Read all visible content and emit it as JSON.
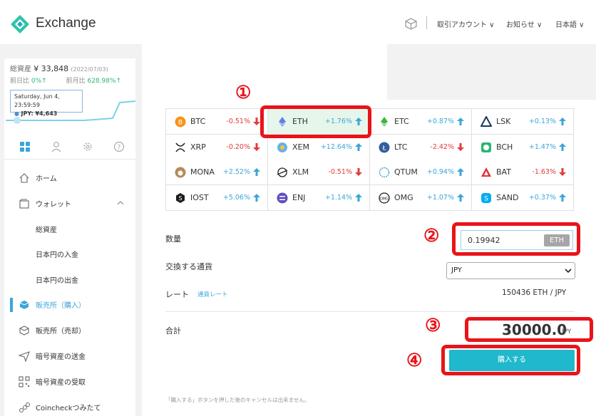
{
  "header": {
    "app_name": "Exchange",
    "links": [
      "取引アカウント ∨",
      "お知らせ ∨",
      "日本語 ∨"
    ]
  },
  "sidebar": {
    "total_label": "総資産",
    "total_value": "¥ 33,848",
    "total_date": "(2022/07/03)",
    "prev_day_label": "前日比",
    "prev_day_value": "0%↑",
    "prev_month_label": "前月比",
    "prev_month_value": "628.98%↑",
    "tooltip_date": "Saturday, Jun 4, 23:59:59",
    "tooltip_value": "JPY: ¥4,643",
    "nav": [
      {
        "label": "ホーム"
      },
      {
        "label": "ウォレット"
      },
      {
        "label": "総資産"
      },
      {
        "label": "日本円の入金"
      },
      {
        "label": "日本円の出金"
      },
      {
        "label": "販売所（購入）"
      },
      {
        "label": "販売所（売却）"
      },
      {
        "label": "暗号資産の送金"
      },
      {
        "label": "暗号資産の受取"
      },
      {
        "label": "Coincheckつみたて"
      }
    ]
  },
  "coins": [
    {
      "symbol": "BTC",
      "change": "-0.51%",
      "dir": "down",
      "color": "#f7931a"
    },
    {
      "symbol": "ETH",
      "change": "+1.76%",
      "dir": "up",
      "color": "#627eea"
    },
    {
      "symbol": "ETC",
      "change": "+0.87%",
      "dir": "up",
      "color": "#3ab83a"
    },
    {
      "symbol": "LSK",
      "change": "+0.13%",
      "dir": "up",
      "color": "#1a3a5c"
    },
    {
      "symbol": "XRP",
      "change": "-0.20%",
      "dir": "down",
      "color": "#222222"
    },
    {
      "symbol": "XEM",
      "change": "+12.64%",
      "dir": "up",
      "color": "#67b2e8"
    },
    {
      "symbol": "LTC",
      "change": "-2.42%",
      "dir": "down",
      "color": "#345d9d"
    },
    {
      "symbol": "BCH",
      "change": "+1.47%",
      "dir": "up",
      "color": "#2bb673"
    },
    {
      "symbol": "MONA",
      "change": "+2.52%",
      "dir": "up",
      "color": "#b68a5a"
    },
    {
      "symbol": "XLM",
      "change": "-0.51%",
      "dir": "down",
      "color": "#222222"
    },
    {
      "symbol": "QTUM",
      "change": "+0.94%",
      "dir": "up",
      "color": "#2e9ad0"
    },
    {
      "symbol": "BAT",
      "change": "-1.63%",
      "dir": "down",
      "color": "#e0303a"
    },
    {
      "symbol": "IOST",
      "change": "+5.06%",
      "dir": "up",
      "color": "#1c1c1c"
    },
    {
      "symbol": "ENJ",
      "change": "+1.14%",
      "dir": "up",
      "color": "#624dbf"
    },
    {
      "symbol": "OMG",
      "change": "+1.07%",
      "dir": "up",
      "color": "#222222"
    },
    {
      "symbol": "SAND",
      "change": "+0.37%",
      "dir": "up",
      "color": "#04adef"
    }
  ],
  "form": {
    "qty_label": "数量",
    "qty_value": "0.19942",
    "qty_unit": "ETH",
    "currency_label": "交換する通貨",
    "currency_value": "JPY",
    "rate_label": "レート",
    "rate_link": "通貨レート",
    "rate_value": "150436  ETH / JPY",
    "total_label": "合計",
    "total_amount": "30000.0",
    "total_unit": "JPY",
    "buy_label": "購入する",
    "note": "「購入する」ボタンを押した後のキャンセルは出来ません。"
  },
  "annotations": [
    "①",
    "②",
    "③",
    "④"
  ],
  "colors": {
    "accent": "#1fb8cd",
    "highlight": "#e8141a",
    "up": "#3aa6d8",
    "down": "#e23b3b"
  }
}
